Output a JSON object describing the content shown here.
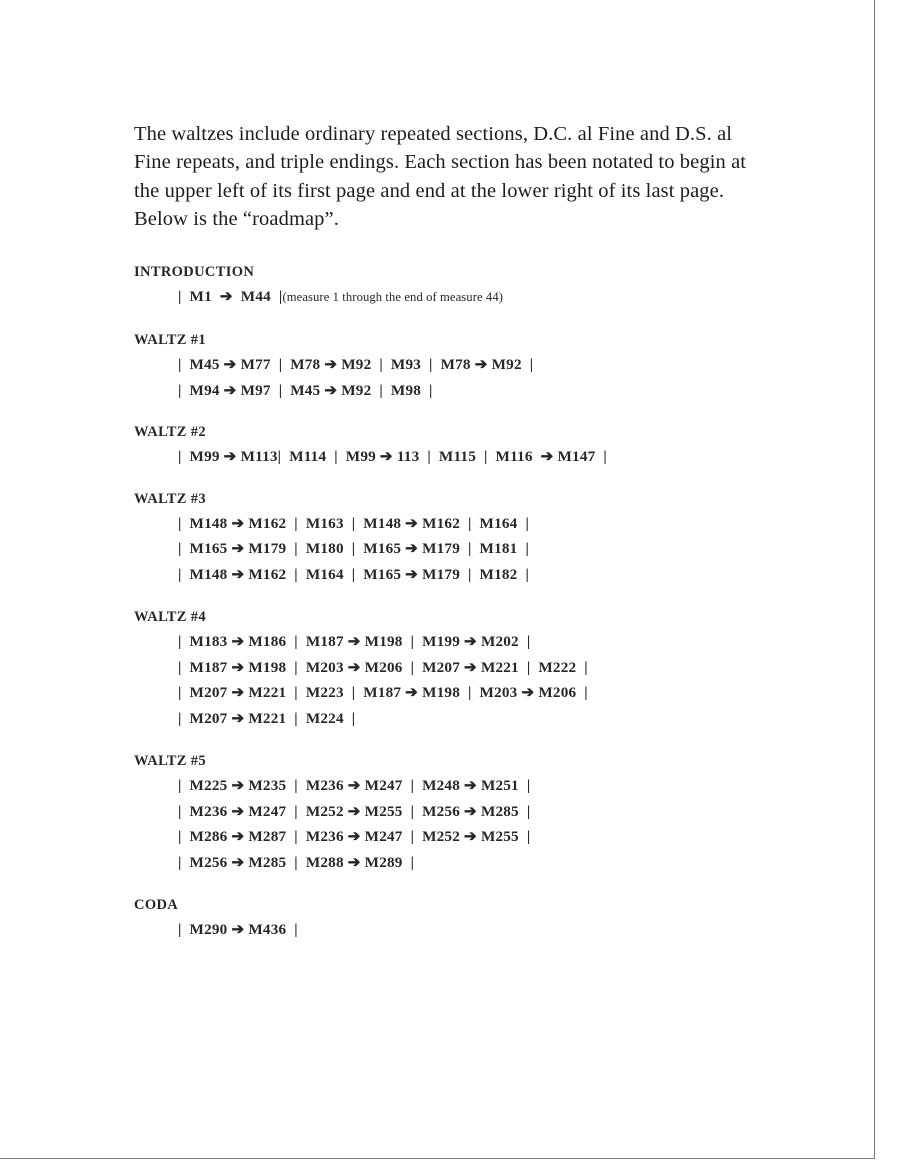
{
  "document": {
    "intro_paragraph": "The waltzes include ordinary repeated sections, D.C. al Fine and D.S. al Fine repeats, and triple endings.  Each section has been notated to begin at the upper left of its first  page and end at the lower right of its last page.  Below is the “roadmap”.",
    "sections": [
      {
        "title": "INTRODUCTION",
        "lines": [
          {
            "text": "|  M1  ➔  M44  |",
            "note": "(measure 1 through the end of measure 44)"
          }
        ]
      },
      {
        "title": "WALTZ #1",
        "lines": [
          {
            "text": "|  M45 ➔ M77  |  M78 ➔ M92  |  M93  |  M78 ➔ M92  |",
            "note": ""
          },
          {
            "text": "|  M94 ➔ M97  |  M45 ➔ M92  |  M98  |",
            "note": ""
          }
        ]
      },
      {
        "title": "WALTZ #2",
        "lines": [
          {
            "text": "|  M99 ➔ M113|  M114  |  M99 ➔ 113  |  M115  |  M116  ➔ M147  |",
            "note": ""
          }
        ]
      },
      {
        "title": "WALTZ #3",
        "lines": [
          {
            "text": "|  M148 ➔ M162  |  M163  |  M148 ➔ M162  |  M164  |",
            "note": ""
          },
          {
            "text": "|  M165 ➔ M179  |  M180  |  M165 ➔ M179  |  M181  |",
            "note": ""
          },
          {
            "text": "|  M148 ➔ M162  |  M164  |  M165 ➔ M179  |  M182  |",
            "note": ""
          }
        ]
      },
      {
        "title": "WALTZ #4",
        "lines": [
          {
            "text": "|  M183 ➔ M186  |  M187 ➔ M198  |  M199 ➔ M202  |",
            "note": ""
          },
          {
            "text": "|  M187 ➔ M198  |  M203 ➔ M206  |  M207 ➔ M221  |  M222  |",
            "note": ""
          },
          {
            "text": "|  M207 ➔ M221  |  M223  |  M187 ➔ M198  |  M203 ➔ M206  |",
            "note": ""
          },
          {
            "text": "|  M207 ➔ M221  |  M224  |",
            "note": ""
          }
        ]
      },
      {
        "title": "WALTZ #5",
        "lines": [
          {
            "text": "|  M225 ➔ M235  |  M236 ➔ M247  |  M248 ➔ M251  |",
            "note": ""
          },
          {
            "text": "|  M236 ➔ M247  |  M252 ➔ M255  |  M256 ➔ M285  |",
            "note": ""
          },
          {
            "text": "|  M286 ➔ M287  |  M236 ➔ M247  |  M252 ➔ M255  |",
            "note": ""
          },
          {
            "text": "|  M256 ➔ M285  |  M288 ➔ M289  |",
            "note": ""
          }
        ]
      },
      {
        "title": "CODA",
        "lines": [
          {
            "text": "|  M290 ➔ M436  |",
            "note": ""
          }
        ]
      }
    ]
  },
  "colors": {
    "text": "#231f1f",
    "border": "#7b7b7b",
    "page_background": "#ffffff"
  }
}
